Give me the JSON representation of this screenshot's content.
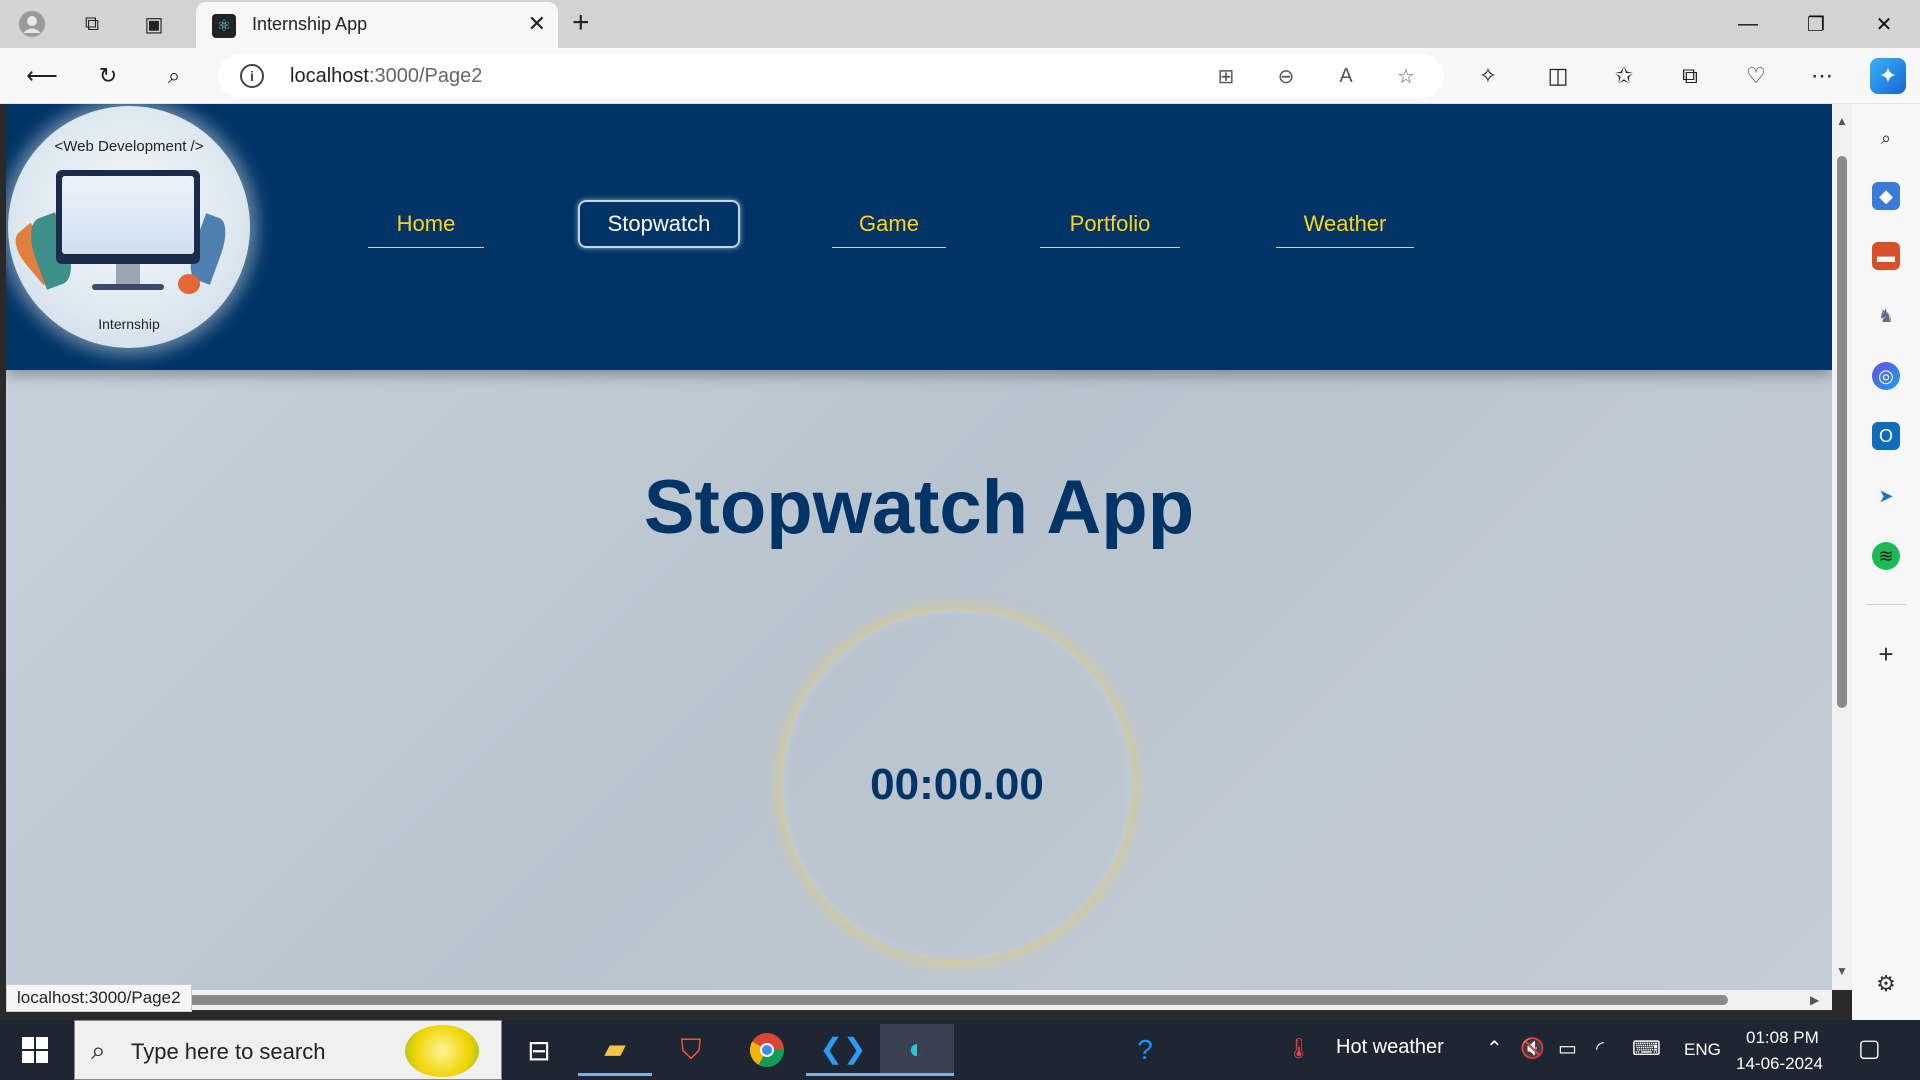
{
  "browser": {
    "tab_title": "Internship App",
    "tab_close": "✕",
    "new_tab": "+",
    "url_host": "localhost",
    "url_path": ":3000/Page2",
    "status_url": "localhost:3000/Page2",
    "window_controls": {
      "minimize": "—",
      "restore": "❐",
      "close": "✕"
    }
  },
  "site": {
    "logo_top_text": "<Web Development />",
    "logo_bottom_text": "Internship",
    "nav": [
      {
        "label": "Home"
      },
      {
        "label": "Stopwatch"
      },
      {
        "label": "Game"
      },
      {
        "label": "Portfolio"
      },
      {
        "label": "Weather"
      }
    ],
    "active_nav": "Stopwatch",
    "heading": "Stopwatch App",
    "time": "00:00.00"
  },
  "taskbar": {
    "search_placeholder": "Type here to search",
    "weather": "Hot weather",
    "language": "ENG",
    "clock_time": "01:08 PM",
    "clock_date": "14-06-2024"
  },
  "colors": {
    "header_bg": "#003366",
    "nav_link": "#ffd21f",
    "heading": "#003366"
  }
}
